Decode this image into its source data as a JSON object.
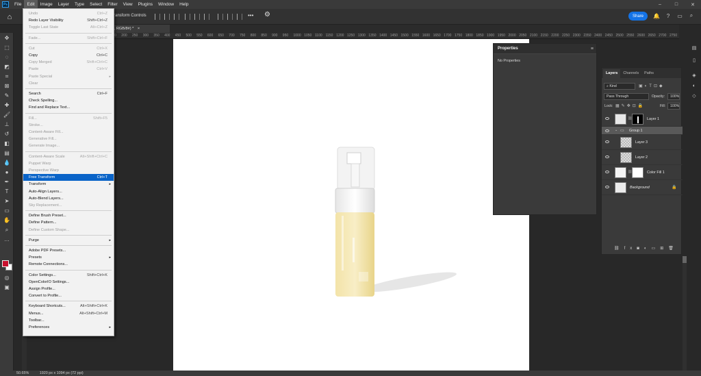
{
  "menubar": {
    "logo": "Ps",
    "items": [
      "File",
      "Edit",
      "Image",
      "Layer",
      "Type",
      "Select",
      "Filter",
      "View",
      "Plugins",
      "Window",
      "Help"
    ],
    "window_controls": [
      "–",
      "□",
      "✕"
    ]
  },
  "options_bar": {
    "transform_controls": "ransform Controls",
    "share_label": "Share",
    "more_label": "•••"
  },
  "document_tab": {
    "label": "6% (Group 1, RGB/8#) *",
    "close": "×"
  },
  "ruler": {
    "ticks": [
      "250",
      "200",
      "150",
      "100",
      "50",
      "0",
      "50",
      "100",
      "150",
      "200",
      "250",
      "300",
      "350",
      "400",
      "450",
      "500",
      "550",
      "600",
      "650",
      "700",
      "750",
      "800",
      "850",
      "900",
      "950",
      "1000",
      "1050",
      "1100",
      "1150",
      "1200",
      "1250",
      "1300",
      "1350",
      "1400",
      "1450",
      "1500",
      "1550",
      "1600",
      "1650",
      "1700",
      "1750",
      "1800",
      "1850",
      "1900",
      "1950",
      "2000",
      "2050",
      "2100",
      "2150",
      "2200",
      "2250",
      "2300",
      "2350",
      "2400",
      "2450",
      "2500",
      "2550",
      "2600",
      "2650",
      "2700",
      "2750"
    ]
  },
  "status_bar": {
    "zoom": "50.65%",
    "doc_info": "1920 px x 1094 px (72 ppi)"
  },
  "properties_panel": {
    "title": "Properties",
    "body": "No Properties"
  },
  "layers_panel": {
    "tabs": [
      "Layers",
      "Channels",
      "Paths"
    ],
    "kind_label": "Kind",
    "blend_mode": "Pass Through",
    "opacity_label": "Opacity:",
    "opacity_value": "100%",
    "lock_label": "Lock:",
    "fill_label": "Fill:",
    "fill_value": "100%",
    "layers": [
      {
        "name": "Layer 1"
      },
      {
        "name": "Group 1"
      },
      {
        "name": "Layer 3"
      },
      {
        "name": "Layer 2"
      },
      {
        "name": "Color Fill 1"
      },
      {
        "name": "Background"
      }
    ],
    "footer_icons": [
      "link-icon",
      "fx-icon",
      "mask-icon",
      "adjustment-icon",
      "folder-icon",
      "new-layer-icon",
      "trash-icon"
    ]
  },
  "edit_menu": {
    "items": [
      {
        "label": "Undo",
        "shortcut": "Ctrl+Z",
        "disabled": true
      },
      {
        "label": "Redo Layer Visibility",
        "shortcut": "Shift+Ctrl+Z",
        "disabled": false
      },
      {
        "label": "Toggle Last State",
        "shortcut": "Alt+Ctrl+Z",
        "disabled": true
      },
      {
        "label": "Fade...",
        "shortcut": "Shift+Ctrl+F",
        "disabled": true
      },
      {
        "label": "Cut",
        "shortcut": "Ctrl+X",
        "disabled": true
      },
      {
        "label": "Copy",
        "shortcut": "Ctrl+C",
        "disabled": false
      },
      {
        "label": "Copy Merged",
        "shortcut": "Shift+Ctrl+C",
        "disabled": true
      },
      {
        "label": "Paste",
        "shortcut": "Ctrl+V",
        "disabled": true
      },
      {
        "label": "Paste Special",
        "shortcut": "",
        "disabled": true
      },
      {
        "label": "Clear",
        "shortcut": "",
        "disabled": true
      },
      {
        "label": "Search",
        "shortcut": "Ctrl+F",
        "disabled": false
      },
      {
        "label": "Check Spelling...",
        "shortcut": "",
        "disabled": false
      },
      {
        "label": "Find and Replace Text...",
        "shortcut": "",
        "disabled": false
      },
      {
        "label": "Fill...",
        "shortcut": "Shift+F5",
        "disabled": true
      },
      {
        "label": "Stroke...",
        "shortcut": "",
        "disabled": true
      },
      {
        "label": "Content-Aware Fill...",
        "shortcut": "",
        "disabled": true
      },
      {
        "label": "Generative Fill...",
        "shortcut": "",
        "disabled": true
      },
      {
        "label": "Generate Image...",
        "shortcut": "",
        "disabled": true
      },
      {
        "label": "Content-Aware Scale",
        "shortcut": "Alt+Shift+Ctrl+C",
        "disabled": true
      },
      {
        "label": "Puppet Warp",
        "shortcut": "",
        "disabled": true
      },
      {
        "label": "Perspective Warp",
        "shortcut": "",
        "disabled": true
      },
      {
        "label": "Free Transform",
        "shortcut": "Ctrl+T",
        "disabled": false,
        "highlighted": true
      },
      {
        "label": "Transform",
        "shortcut": "",
        "disabled": false
      },
      {
        "label": "Auto-Align Layers...",
        "shortcut": "",
        "disabled": false
      },
      {
        "label": "Auto-Blend Layers...",
        "shortcut": "",
        "disabled": false
      },
      {
        "label": "Sky Replacement...",
        "shortcut": "",
        "disabled": true
      },
      {
        "label": "Define Brush Preset...",
        "shortcut": "",
        "disabled": false
      },
      {
        "label": "Define Pattern...",
        "shortcut": "",
        "disabled": false
      },
      {
        "label": "Define Custom Shape...",
        "shortcut": "",
        "disabled": true
      },
      {
        "label": "Purge",
        "shortcut": "",
        "disabled": false
      },
      {
        "label": "Adobe PDF Presets...",
        "shortcut": "",
        "disabled": false
      },
      {
        "label": "Presets",
        "shortcut": "",
        "disabled": false
      },
      {
        "label": "Remote Connections...",
        "shortcut": "",
        "disabled": false
      },
      {
        "label": "Color Settings...",
        "shortcut": "Shift+Ctrl+K",
        "disabled": false
      },
      {
        "label": "OpenColorIO Settings...",
        "shortcut": "",
        "disabled": false
      },
      {
        "label": "Assign Profile...",
        "shortcut": "",
        "disabled": false
      },
      {
        "label": "Convert to Profile...",
        "shortcut": "",
        "disabled": false
      },
      {
        "label": "Keyboard Shortcuts...",
        "shortcut": "Alt+Shift+Ctrl+K",
        "disabled": false
      },
      {
        "label": "Menus...",
        "shortcut": "Alt+Shift+Ctrl+M",
        "disabled": false
      },
      {
        "label": "Toolbar...",
        "shortcut": "",
        "disabled": false
      },
      {
        "label": "Preferences",
        "shortcut": "",
        "disabled": false
      }
    ]
  },
  "colors": {
    "foreground": "#c8102e",
    "background": "#ffffff",
    "accent": "#1473e6",
    "menu_highlight": "#0a64c8"
  }
}
